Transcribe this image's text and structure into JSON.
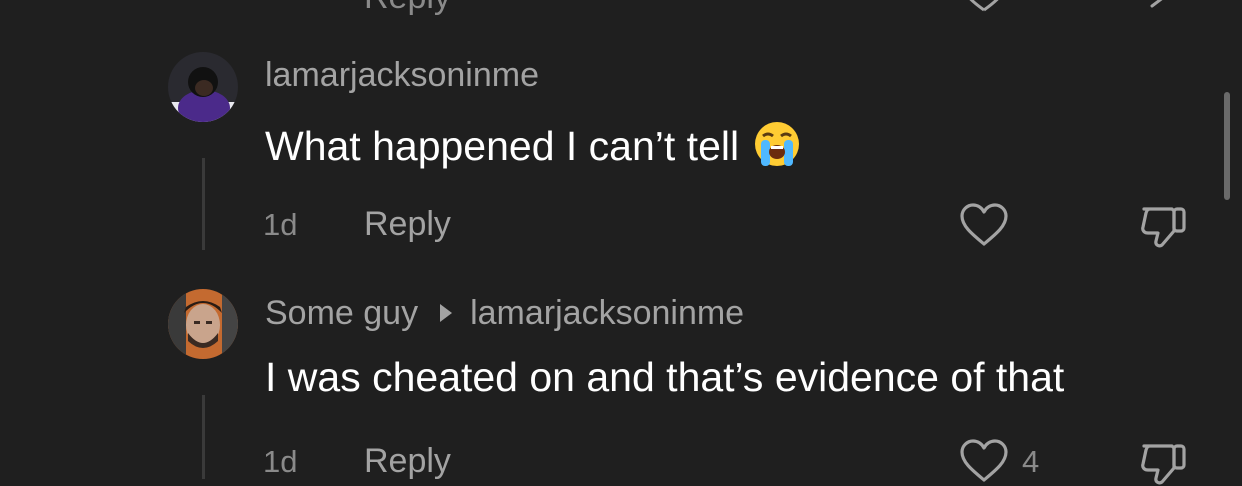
{
  "previous_row": {
    "reply_label": "Reply"
  },
  "comments": [
    {
      "username": "lamarjacksoninme",
      "text": "What happened I can’t tell",
      "emoji": "loudly-crying-face",
      "time": "1d",
      "reply_label": "Reply",
      "like_count": ""
    },
    {
      "username": "Some guy",
      "reply_to": "lamarjacksoninme",
      "text": "I was cheated on and that’s evidence of that",
      "time": "1d",
      "reply_label": "Reply",
      "like_count": "4"
    }
  ],
  "icons": {
    "like": "heart-outline-icon",
    "dislike": "thumbs-down-outline-icon",
    "reply_arrow": "play-caret-icon"
  },
  "colors": {
    "background": "#1f1f1f",
    "text_primary": "#ffffff",
    "text_secondary": "#a3a3a3",
    "text_muted": "#8a8a8a"
  }
}
